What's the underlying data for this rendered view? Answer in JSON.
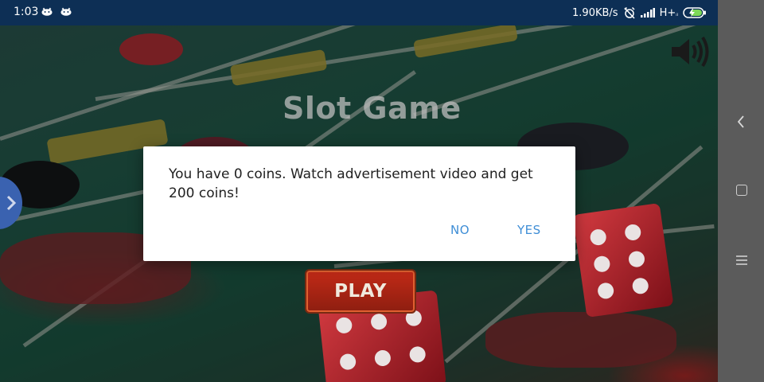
{
  "status_bar": {
    "time": "1:03",
    "net_speed": "1.90KB/s",
    "network_type": "H+",
    "icons": [
      "app-notification-icon",
      "app-notification-icon",
      "alarm-off-icon",
      "signal-icon",
      "battery-charging-icon"
    ]
  },
  "game": {
    "title": "Slot Game",
    "play_label": "PLAY"
  },
  "dialog": {
    "message": "You have 0 coins. Watch advertisement video and get 200 coins!",
    "no_label": "NO",
    "yes_label": "YES"
  },
  "colors": {
    "status_bar_bg": "#0d2f55",
    "dialog_button": "#3f8ed6",
    "nav_bar_bg": "#5b5b5b",
    "play_button": "#c22a17"
  },
  "nav_bar": {
    "icons": [
      "back-icon",
      "home-icon",
      "menu-icon"
    ]
  }
}
